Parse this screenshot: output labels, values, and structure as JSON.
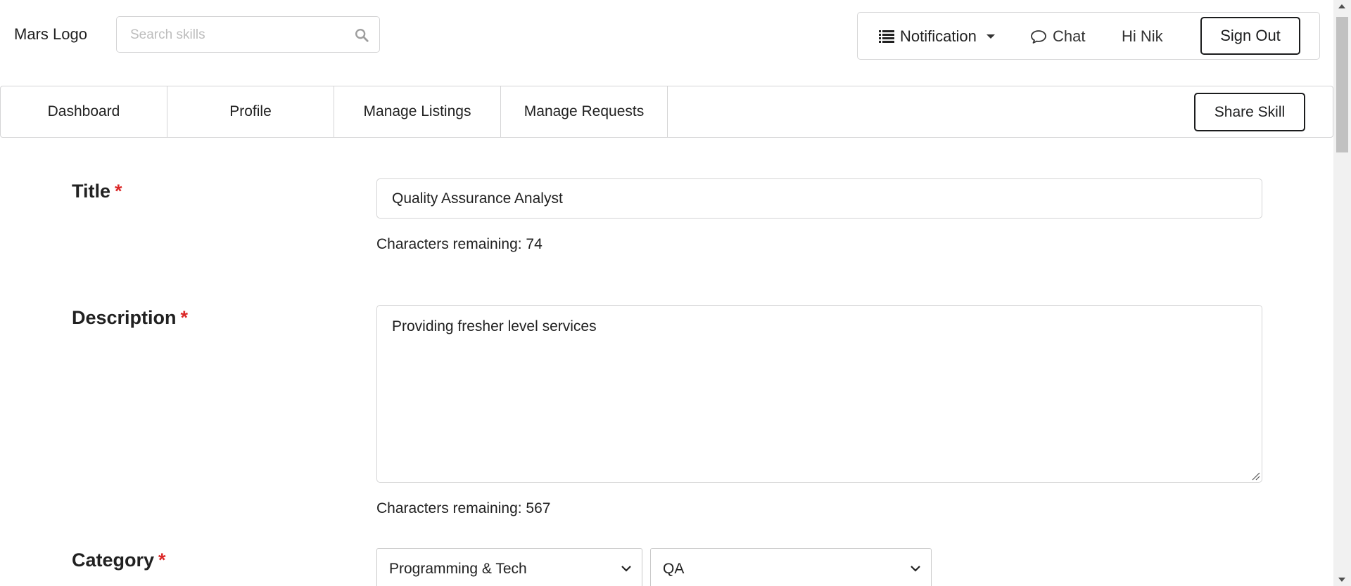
{
  "header": {
    "logo": "Mars Logo",
    "search_placeholder": "Search skills",
    "menu": {
      "notification": "Notification",
      "chat": "Chat",
      "greeting": "Hi Nik",
      "sign_out": "Sign Out"
    }
  },
  "nav": {
    "items": [
      {
        "label": "Dashboard"
      },
      {
        "label": "Profile"
      },
      {
        "label": "Manage Listings"
      },
      {
        "label": "Manage Requests"
      }
    ],
    "share_skill": "Share Skill"
  },
  "form": {
    "required_marker": "*",
    "title": {
      "label": "Title",
      "value": "Quality Assurance Analyst",
      "chars_remaining": "Characters remaining: 74"
    },
    "description": {
      "label": "Description",
      "value": "Providing fresher level services",
      "chars_remaining": "Characters remaining: 567"
    },
    "category": {
      "label": "Category",
      "selected": "Programming & Tech",
      "subcategory_selected": "QA"
    }
  },
  "colors": {
    "required": "#db2828",
    "border": "#d4d4d5",
    "text": "#212121"
  }
}
